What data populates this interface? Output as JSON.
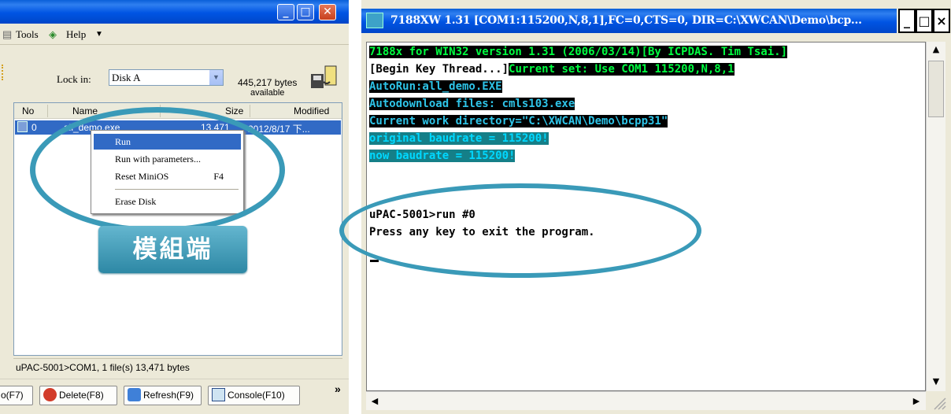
{
  "left_window": {
    "menu": {
      "tools": "Tools",
      "help": "Help"
    },
    "lock_in_label": "Lock in:",
    "lock_in_value": "Disk A",
    "free_bytes": "445,217 bytes",
    "available": "available",
    "columns": {
      "no": "No",
      "name": "Name",
      "size": "Size",
      "modified": "Modified"
    },
    "selected_row": {
      "no": "0",
      "name": "all_demo.exe",
      "size": "13,471",
      "modified": "2012/8/17 下..."
    },
    "context_menu": {
      "run": "Run",
      "run_with_params": "Run with parameters...",
      "reset_minios": "Reset MiniOS",
      "reset_shortcut": "F4",
      "erase_disk": "Erase Disk"
    },
    "status": "uPAC-5001>COM1, 1 file(s) 13,471 bytes",
    "buttons": {
      "partial": "o(F7)",
      "delete": "Delete(F8)",
      "refresh": "Refresh(F9)",
      "console": "Console(F10)"
    },
    "overflow": "»"
  },
  "annotation_label": "模組端",
  "right_window": {
    "title": "7188XW 1.31 [COM1:115200,N,8,1],FC=0,CTS=0, DIR=C:\\XWCAN\\Demo\\bcp...",
    "title_buttons": {
      "minimize": "_",
      "maximize": "□",
      "close": "×"
    },
    "lines": [
      "7188x for WIN32 version 1.31 (2006/03/14)[By ICPDAS. Tim Tsai.]",
      "[Begin Key Thread...]",
      "Current set: Use COM1 115200,N,8,1",
      "AutoRun:all_demo.EXE",
      "Autodownload files: cmls103.exe",
      "Current work directory=\"C:\\XWCAN\\Demo\\bcpp31\"",
      "original baudrate = 115200!",
      "now baudrate = 115200!",
      "uPAC-5001>run #0",
      "Press any key to exit the program."
    ]
  },
  "colors": {
    "xp_blue": "#0054e3",
    "annot": "#3a9ab8",
    "term_green": "#00ff40",
    "term_teal": "#157f88",
    "selection": "#316ac5"
  },
  "icons": [
    "minimize-icon",
    "maximize-icon",
    "close-icon",
    "help-icon",
    "disk-icon",
    "file-icon",
    "delete-icon",
    "refresh-icon",
    "console-icon",
    "scroll-up-icon",
    "scroll-down-icon",
    "scroll-left-icon",
    "scroll-right-icon"
  ]
}
